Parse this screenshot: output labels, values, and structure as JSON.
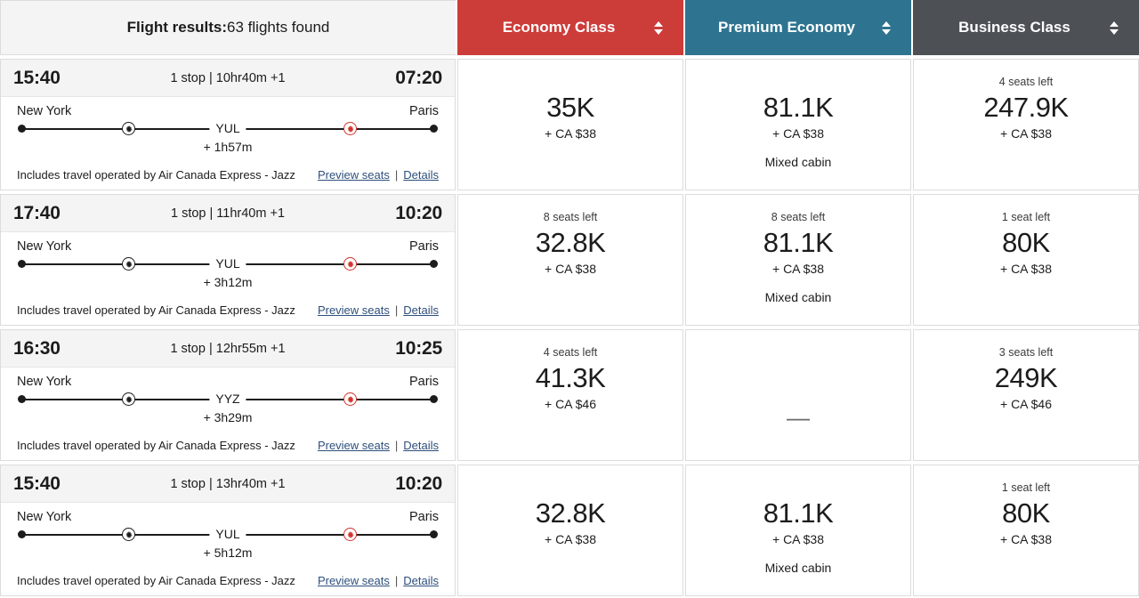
{
  "header": {
    "results_label": "Flight results:",
    "results_count": "63 flights found",
    "columns": [
      {
        "label": "Economy Class",
        "color": "#cc3c39",
        "sort_icon": "sort-arrows-icon"
      },
      {
        "label": "Premium Economy",
        "color": "#2e7490",
        "sort_icon": "sort-arrows-icon"
      },
      {
        "label": "Business Class",
        "color": "#4d5054",
        "sort_icon": "sort-arrows-icon"
      }
    ]
  },
  "links": {
    "preview_seats": "Preview seats",
    "separator": "|",
    "details": "Details"
  },
  "flights": [
    {
      "depart_time": "15:40",
      "arrive_time": "07:20",
      "stops_duration": "1 stop | 10hr40m +1",
      "origin_city": "New York",
      "destination_city": "Paris",
      "stop_code": "YUL",
      "layover": "+ 1h57m",
      "operator": "Includes travel operated by Air Canada Express - Jazz",
      "fares": [
        {
          "seats_left": "",
          "points": "35K",
          "taxes": "+ CA $38",
          "note": "",
          "available": true
        },
        {
          "seats_left": "",
          "points": "81.1K",
          "taxes": "+ CA $38",
          "note": "Mixed cabin",
          "available": true
        },
        {
          "seats_left": "4 seats left",
          "points": "247.9K",
          "taxes": "+ CA $38",
          "note": "",
          "available": true
        }
      ]
    },
    {
      "depart_time": "17:40",
      "arrive_time": "10:20",
      "stops_duration": "1 stop | 11hr40m +1",
      "origin_city": "New York",
      "destination_city": "Paris",
      "stop_code": "YUL",
      "layover": "+ 3h12m",
      "operator": "Includes travel operated by Air Canada Express - Jazz",
      "fares": [
        {
          "seats_left": "8 seats left",
          "points": "32.8K",
          "taxes": "+ CA $38",
          "note": "",
          "available": true
        },
        {
          "seats_left": "8 seats left",
          "points": "81.1K",
          "taxes": "+ CA $38",
          "note": "Mixed cabin",
          "available": true
        },
        {
          "seats_left": "1 seat left",
          "points": "80K",
          "taxes": "+ CA $38",
          "note": "",
          "available": true
        }
      ]
    },
    {
      "depart_time": "16:30",
      "arrive_time": "10:25",
      "stops_duration": "1 stop | 12hr55m +1",
      "origin_city": "New York",
      "destination_city": "Paris",
      "stop_code": "YYZ",
      "layover": "+ 3h29m",
      "operator": "Includes travel operated by Air Canada Express - Jazz",
      "fares": [
        {
          "seats_left": "4 seats left",
          "points": "41.3K",
          "taxes": "+ CA $46",
          "note": "",
          "available": true
        },
        {
          "seats_left": "",
          "points": "—",
          "taxes": "",
          "note": "",
          "available": false
        },
        {
          "seats_left": "3 seats left",
          "points": "249K",
          "taxes": "+ CA $46",
          "note": "",
          "available": true
        }
      ]
    },
    {
      "depart_time": "15:40",
      "arrive_time": "10:20",
      "stops_duration": "1 stop | 13hr40m +1",
      "origin_city": "New York",
      "destination_city": "Paris",
      "stop_code": "YUL",
      "layover": "+ 5h12m",
      "operator": "Includes travel operated by Air Canada Express - Jazz",
      "fares": [
        {
          "seats_left": "",
          "points": "32.8K",
          "taxes": "+ CA $38",
          "note": "",
          "available": true
        },
        {
          "seats_left": "",
          "points": "81.1K",
          "taxes": "+ CA $38",
          "note": "Mixed cabin",
          "available": true
        },
        {
          "seats_left": "1 seat left",
          "points": "80K",
          "taxes": "+ CA $38",
          "note": "",
          "available": true
        }
      ]
    }
  ]
}
